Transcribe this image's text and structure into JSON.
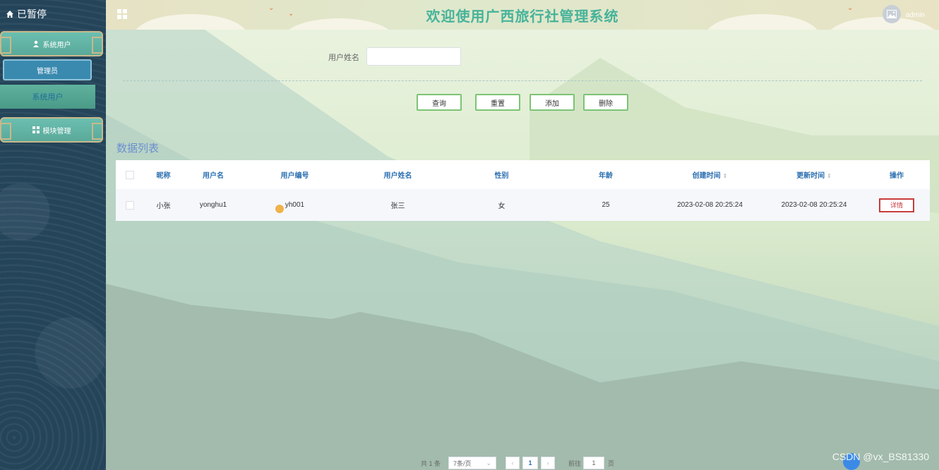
{
  "sidebar": {
    "brand": "已暂停",
    "groups": [
      {
        "label": "系统用户",
        "icon": "user-icon"
      },
      {
        "label": "模块管理",
        "icon": "grid-icon"
      }
    ],
    "sub_items": [
      {
        "label": "管理员",
        "active": true
      },
      {
        "label": "系统用户",
        "active": false
      }
    ]
  },
  "header": {
    "title": "欢迎使用广西旅行社管理系统",
    "user": "admin"
  },
  "search": {
    "label": "用户姓名",
    "value": "",
    "placeholder": ""
  },
  "buttons": {
    "query": "查询",
    "reset": "重置",
    "add": "添加",
    "delete": "删除"
  },
  "list_title": "数据列表",
  "table": {
    "columns": [
      "昵称",
      "用户名",
      "用户编号",
      "用户姓名",
      "性别",
      "年龄",
      "创建时间",
      "更新时间",
      "操作"
    ],
    "rows": [
      [
        "小张",
        "yonghu1",
        "yh001",
        "张三",
        "女",
        "25",
        "2023-02-08 20:25:24",
        "2023-02-08 20:25:24",
        "详情"
      ]
    ]
  },
  "pagination": {
    "total": "共 1 条",
    "page_size": "7条/页",
    "current_page": "1",
    "goto_label": "前往",
    "goto_value": "1",
    "page_suffix": "页"
  },
  "watermark": "CSDN @vx_BS81330",
  "colors": {
    "accent": "#46b39a",
    "sidebar_bg": "#24445a",
    "table_header_text": "#2c6fb1",
    "detail_button": "#c83c3c"
  }
}
